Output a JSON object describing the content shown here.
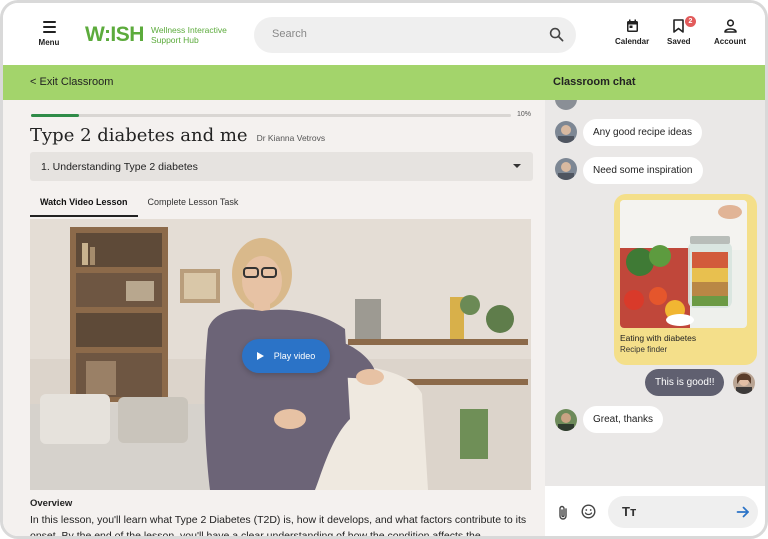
{
  "header": {
    "menu_label": "Menu",
    "logo_mark": "W:ISH",
    "logo_sub_line1": "Wellness Interactive",
    "logo_sub_line2": "Support Hub",
    "search_placeholder": "Search",
    "calendar_label": "Calendar",
    "saved_label": "Saved",
    "saved_badge": "2",
    "account_label": "Account"
  },
  "bar": {
    "exit_label": "< Exit Classroom",
    "chat_title": "Classroom chat"
  },
  "lesson": {
    "progress_label": "10%",
    "progress_fraction": 0.1,
    "title": "Type 2 diabetes and me",
    "author": "Dr Kianna Vetrovs",
    "selected_module": "1. Understanding Type 2 diabetes",
    "tabs": [
      {
        "label": "Watch Video Lesson",
        "active": true
      },
      {
        "label": "Complete Lesson Task",
        "active": false
      }
    ],
    "play_label": "Play video",
    "overview_heading": "Overview",
    "overview_text": "In this lesson, you'll learn what Type 2 Diabetes (T2D) is, how it develops, and what factors contribute to its onset. By the end of the lesson, you'll have a clear understanding of how the condition affects the"
  },
  "chat": {
    "messages": [
      {
        "text": "Any good recipe ideas",
        "from": "other"
      },
      {
        "text": "Need some inspiration",
        "from": "other"
      },
      {
        "text": "This is good!!",
        "from": "me"
      },
      {
        "text": "Great, thanks",
        "from": "other"
      }
    ],
    "shared_card": {
      "title": "Eating with diabetes",
      "subtitle": "Recipe finder"
    }
  },
  "colors": {
    "brand_green": "#5cab3c",
    "bar_green": "#a3d46b",
    "play_blue": "#2b73c7",
    "share_card_yellow": "#f4df8a",
    "my_bubble": "#606070",
    "progress_fill": "#2e8b47"
  }
}
